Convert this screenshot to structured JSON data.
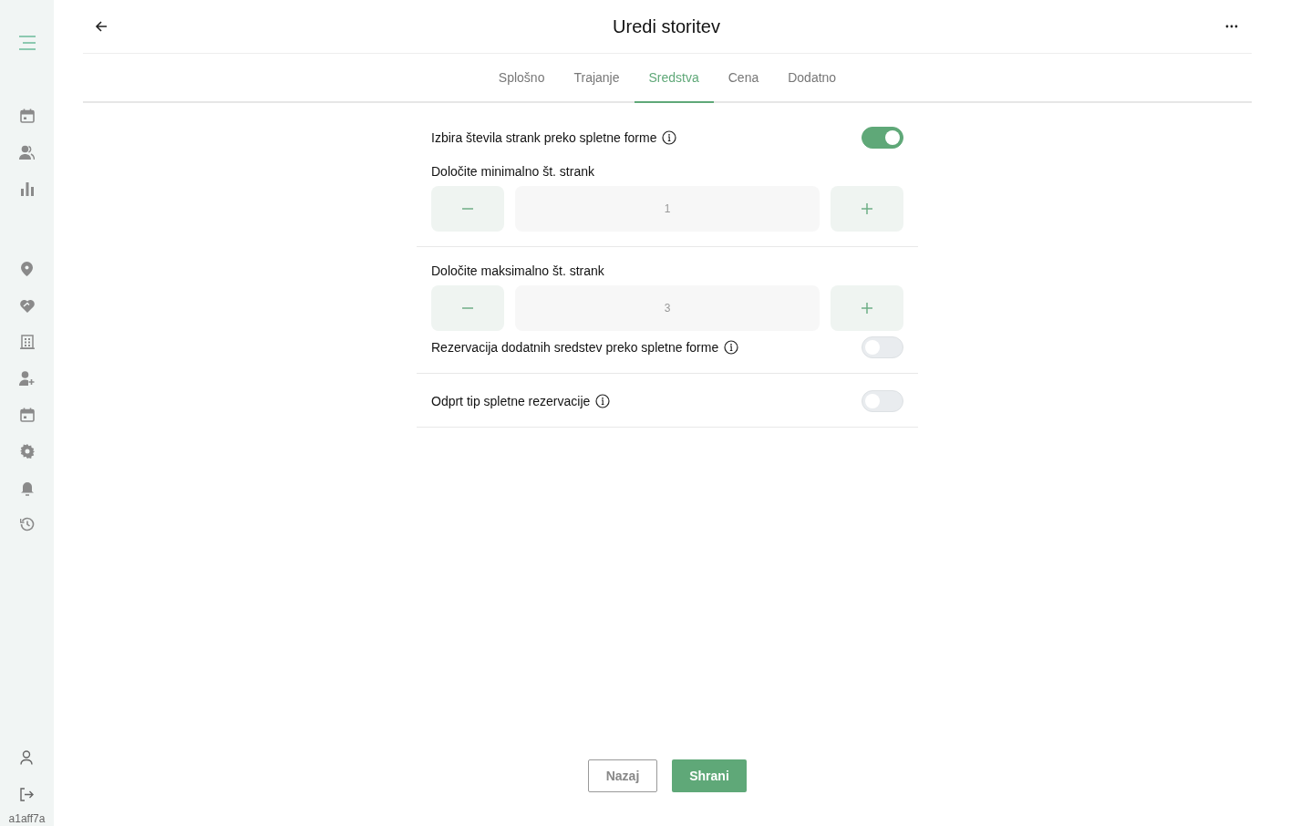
{
  "header": {
    "title": "Uredi storitev"
  },
  "tabs": [
    {
      "label": "Splošno",
      "selected": false
    },
    {
      "label": "Trajanje",
      "selected": false
    },
    {
      "label": "Sredstva",
      "selected": true
    },
    {
      "label": "Cena",
      "selected": false
    },
    {
      "label": "Dodatno",
      "selected": false
    }
  ],
  "sections": [
    {
      "items": [
        {
          "kind": "toggle",
          "label": "Izbira števila strank preko spletne forme",
          "on": true
        },
        {
          "kind": "stepper",
          "label": "Določite minimalno št. strank",
          "value": "1"
        }
      ]
    },
    {
      "items": [
        {
          "kind": "stepper",
          "label": "Določite maksimalno št. strank",
          "value": "3"
        },
        {
          "kind": "toggle",
          "label": "Rezervacija dodatnih sredstev preko spletne forme",
          "on": false
        }
      ]
    },
    {
      "items": [
        {
          "kind": "toggle",
          "label": "Odprt tip spletne rezervacije",
          "on": false
        }
      ]
    }
  ],
  "buttons": {
    "back": "Nazaj",
    "save": "Shrani"
  },
  "sidebar": {
    "version": "a1aff7a"
  }
}
